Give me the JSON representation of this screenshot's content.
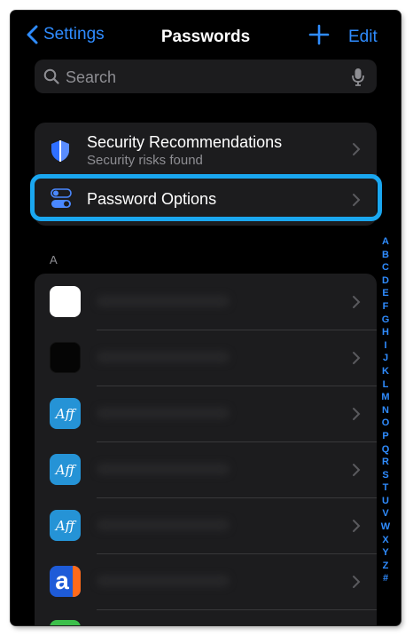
{
  "nav": {
    "back_label": "Settings",
    "title": "Passwords",
    "edit_label": "Edit"
  },
  "search": {
    "placeholder": "Search"
  },
  "security": {
    "title": "Security Recommendations",
    "subtitle": "Security risks found"
  },
  "options": {
    "title": "Password Options"
  },
  "section": {
    "label": "A"
  },
  "list_items": [
    {
      "icon": "white-app-icon"
    },
    {
      "icon": "black-app-icon"
    },
    {
      "icon": "aff-app-icon",
      "icon_text": "Aff"
    },
    {
      "icon": "aff-app-icon",
      "icon_text": "Aff"
    },
    {
      "icon": "aff-app-icon",
      "icon_text": "Aff"
    },
    {
      "icon": "a-app-icon",
      "icon_text": "a"
    },
    {
      "icon": "green-app-icon"
    }
  ],
  "index_letters": [
    "A",
    "B",
    "C",
    "D",
    "E",
    "F",
    "G",
    "H",
    "I",
    "J",
    "K",
    "L",
    "M",
    "N",
    "O",
    "P",
    "Q",
    "R",
    "S",
    "T",
    "U",
    "V",
    "W",
    "X",
    "Y",
    "Z",
    "#"
  ],
  "colors": {
    "accent": "#2f8cff",
    "highlight": "#1aa7f0",
    "background": "#000000",
    "cell": "#1c1c1e"
  }
}
